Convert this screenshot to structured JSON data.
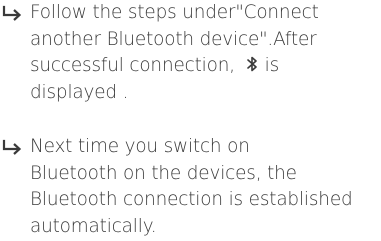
{
  "steps": [
    {
      "arrow_icon": "return-arrow-icon",
      "lines": [
        "Follow the steps under\"Connect",
        "another Bluetooth device\".After",
        "successful connection,",
        "is",
        "displayed ."
      ],
      "inline_icon": "bluetooth-icon"
    },
    {
      "arrow_icon": "return-arrow-icon",
      "lines": [
        "Next time you switch on",
        "Bluetooth on the devices, the",
        "Bluetooth connection is established",
        "automatically."
      ]
    }
  ],
  "colors": {
    "text": "#3a3a3a",
    "accent": "#3a3a3a"
  }
}
